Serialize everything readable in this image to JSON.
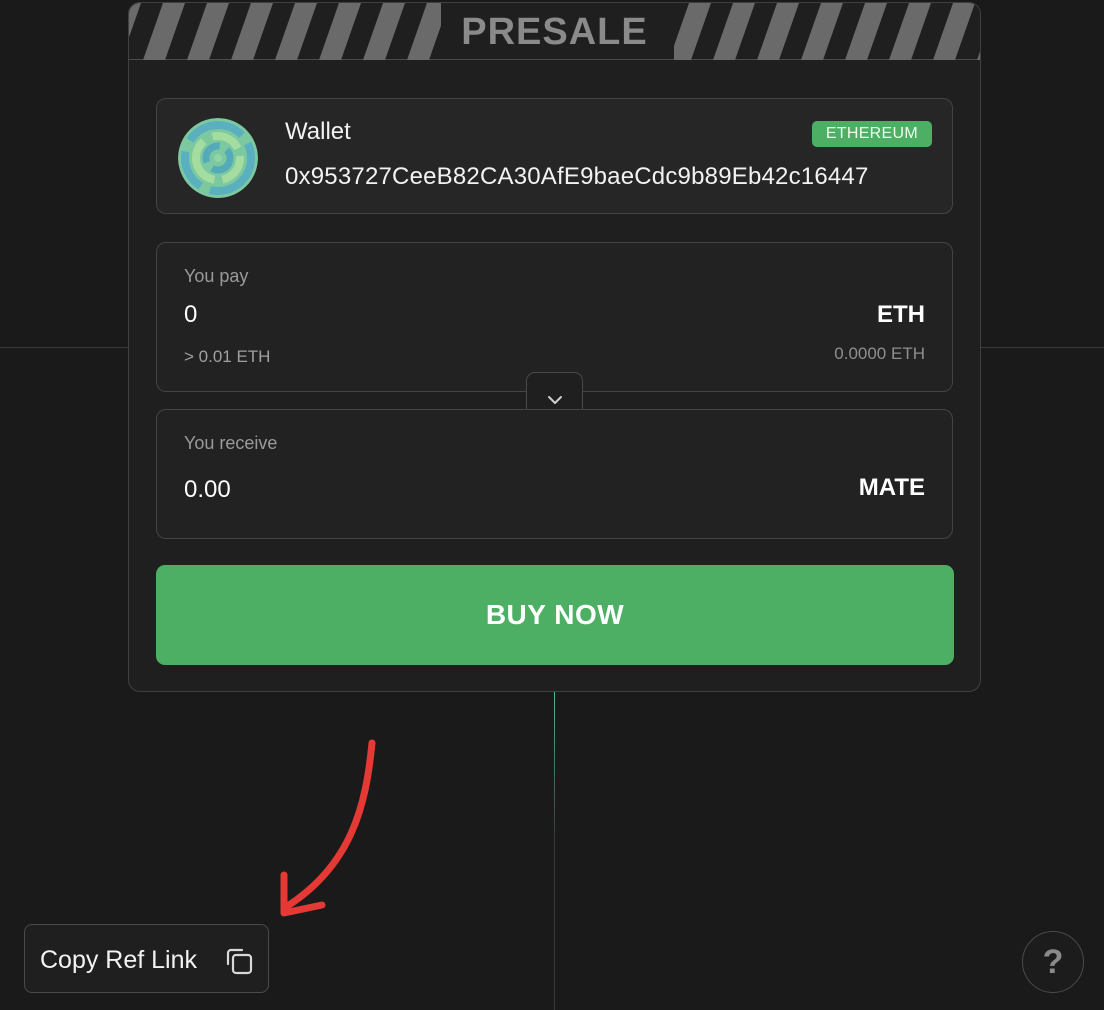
{
  "presale": {
    "title": "PRESALE",
    "wallet": {
      "label": "Wallet",
      "address": "0x953727CeeB82CA30AfE9baeCdc9b89Eb42c16447",
      "network": "ETHEREUM"
    },
    "pay": {
      "caption": "You pay",
      "value": "0",
      "currency": "ETH",
      "minimum": "> 0.01 ETH",
      "balance": "0.0000 ETH"
    },
    "receive": {
      "caption": "You receive",
      "value": "0.00",
      "currency": "MATE"
    },
    "buy_label": "BUY NOW"
  },
  "ref_link": {
    "label": "Copy Ref Link"
  },
  "help": {
    "label": "?"
  },
  "colors": {
    "accent": "#4caf63",
    "background": "#1a1a1a",
    "annotation": "#e53935"
  },
  "icons": {
    "swap": "chevron-down-icon",
    "copy": "copy-icon",
    "avatar": "wallet-avatar-icon"
  }
}
